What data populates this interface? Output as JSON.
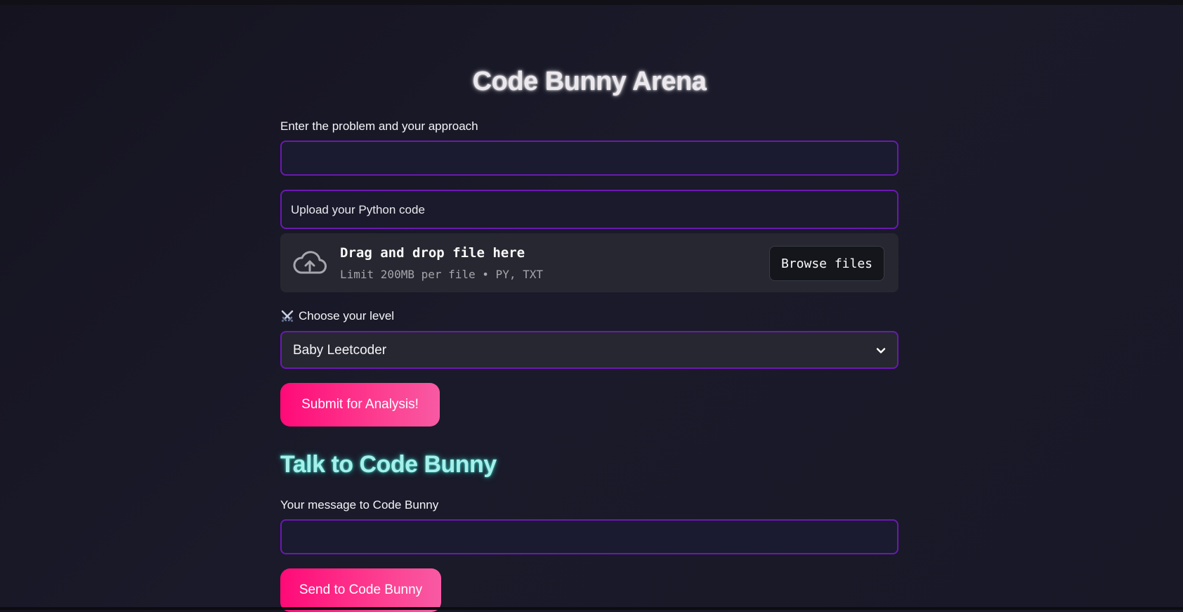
{
  "page": {
    "title": "Code Bunny Arena"
  },
  "problem_input": {
    "label": "Enter the problem and your approach",
    "value": "",
    "placeholder": ""
  },
  "uploader": {
    "label": "Upload your Python code",
    "drop_title": "Drag and drop file here",
    "drop_subtitle": "Limit 200MB per file • PY, TXT",
    "browse_label": "Browse files",
    "icon": "cloud-upload-icon"
  },
  "level": {
    "label": "Choose your level",
    "icon": "crossed-swords-icon",
    "selected": "Baby Leetcoder"
  },
  "submit_button": {
    "label": "Submit for Analysis!"
  },
  "chat": {
    "heading": "Talk to Code Bunny",
    "message_label": "Your message to Code Bunny",
    "message_value": "",
    "send_label": "Send to Code Bunny"
  },
  "colors": {
    "accent_pink": "#ff0a78",
    "border_purple": "#6a1ab0",
    "heading_cyan": "#a7f0ea",
    "background": "#16151f"
  }
}
